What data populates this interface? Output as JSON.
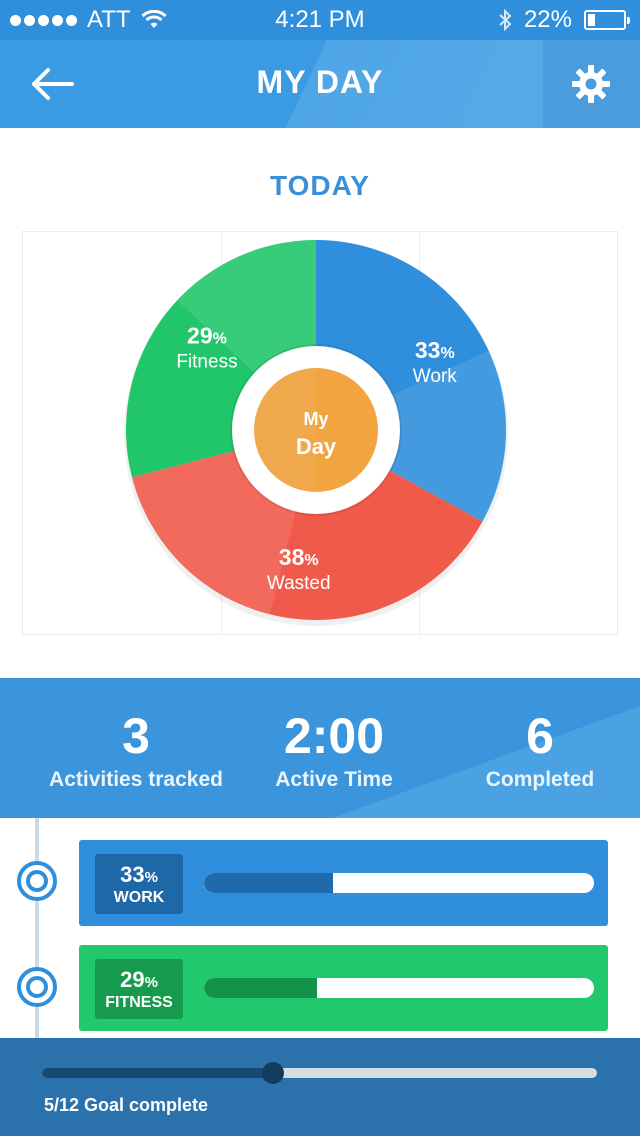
{
  "status_bar": {
    "carrier": "ATT",
    "time": "4:21 PM",
    "battery": "22%",
    "battery_level": 0.22,
    "icons": [
      "signal-dots-icon",
      "wifi-icon",
      "bluetooth-icon",
      "battery-icon"
    ]
  },
  "header": {
    "title": "MY DAY",
    "back_icon": "back-arrow-icon",
    "settings_icon": "gear-icon"
  },
  "chart_data": {
    "type": "pie",
    "title": "TODAY",
    "center_label_line1": "My",
    "center_label_line2": "Day",
    "slices": [
      {
        "name": "Work",
        "value": 33,
        "color": "#2f8fdc",
        "text": "33",
        "unit": "%"
      },
      {
        "name": "Wasted",
        "value": 38,
        "color": "#f05a4a",
        "text": "38",
        "unit": "%"
      },
      {
        "name": "Fitness",
        "value": 29,
        "color": "#22c66a",
        "text": "29",
        "unit": "%"
      }
    ]
  },
  "stats": [
    {
      "value": "3",
      "label": "Activities tracked"
    },
    {
      "value": "2:00",
      "label": "Active Time"
    },
    {
      "value": "6",
      "label": "Completed"
    }
  ],
  "activities": [
    {
      "pct": "33",
      "unit": "%",
      "name": "WORK",
      "progress": 0.33,
      "color": "#2f8fdc",
      "badge_color": "#1f68a8",
      "bar_color": "#1e6aaa"
    },
    {
      "pct": "29",
      "unit": "%",
      "name": "FITNESS",
      "progress": 0.29,
      "color": "#22c86c",
      "badge_color": "#169a4d",
      "bar_color": "#13934a"
    }
  ],
  "goal": {
    "label": "5/12 Goal complete",
    "progress": 0.4167
  }
}
